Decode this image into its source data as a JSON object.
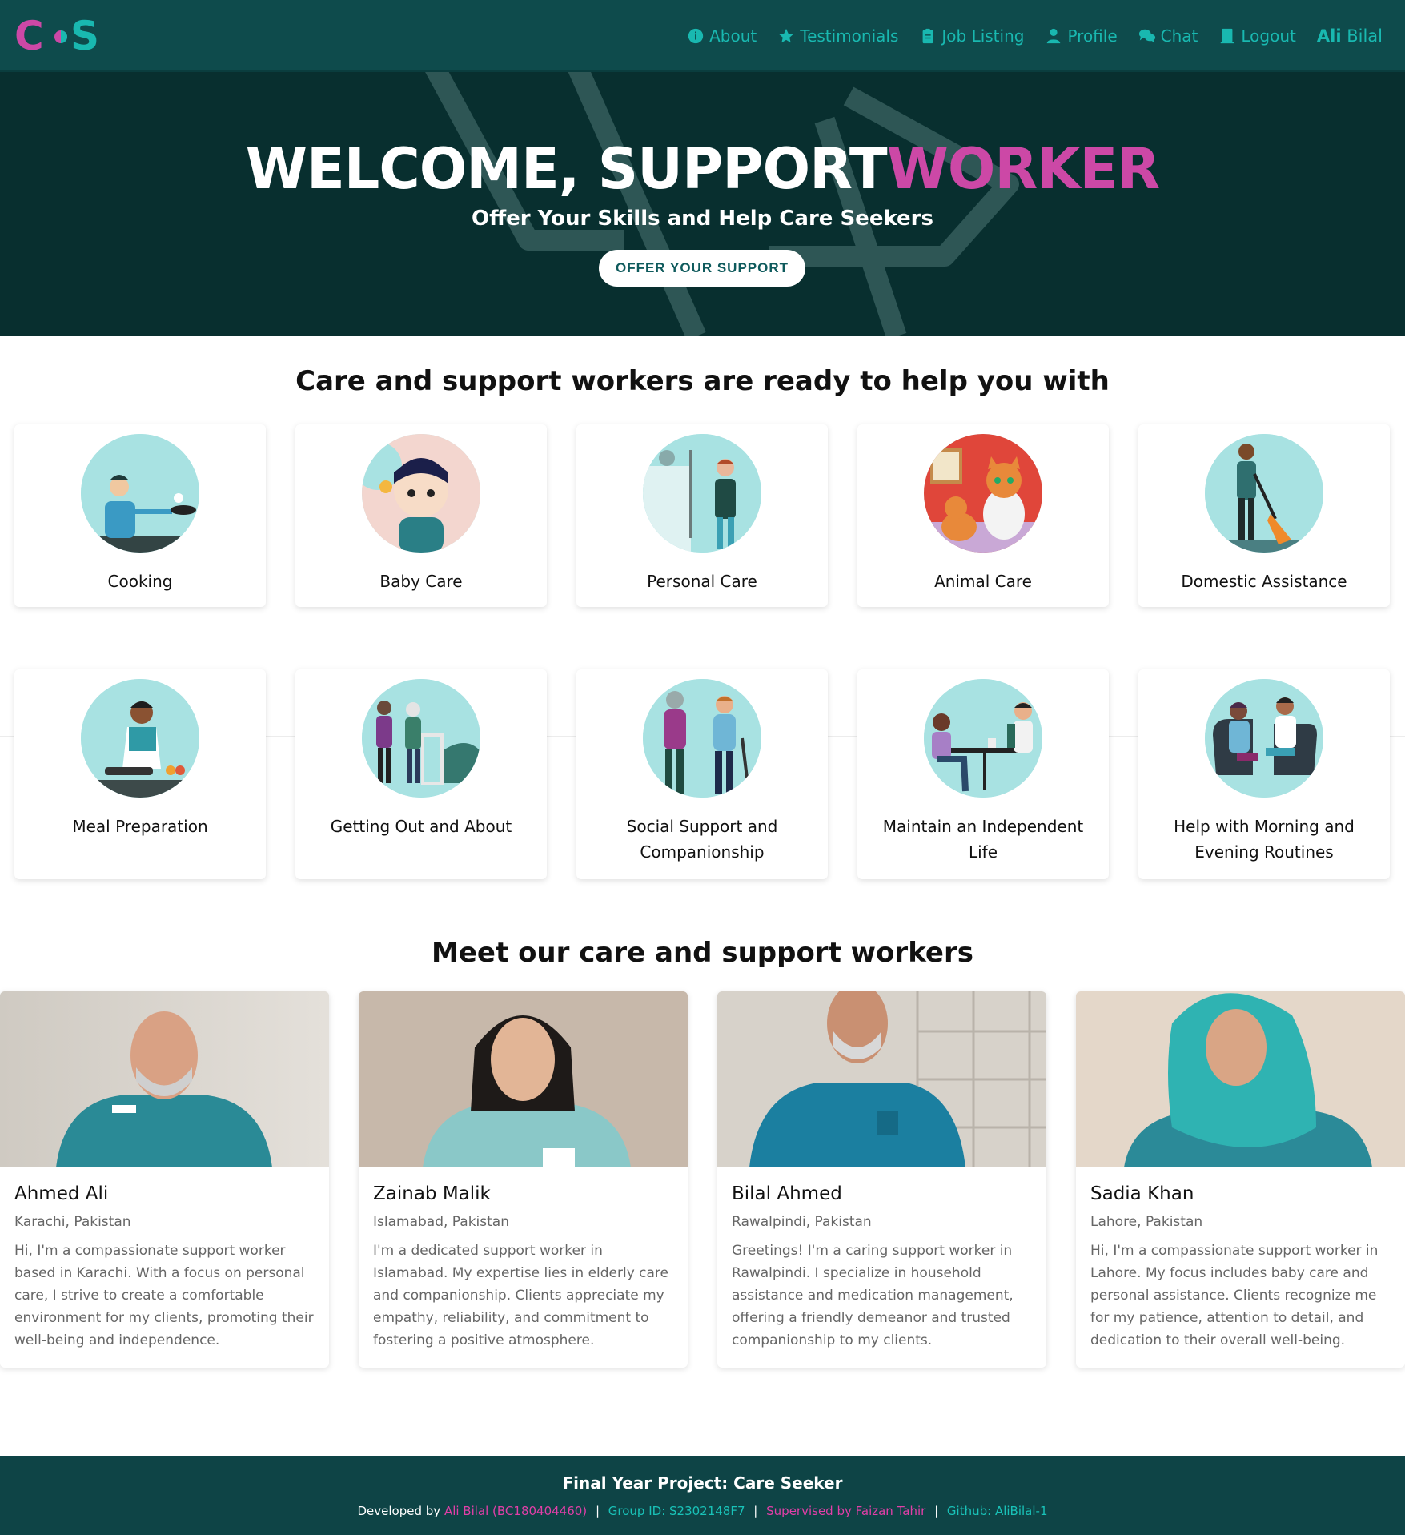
{
  "brand": {
    "logo_text": "C•S",
    "colors": {
      "pink": "#cc48a6",
      "teal": "#19b8b0",
      "dark": "#0e4b4c"
    }
  },
  "nav": {
    "items": [
      {
        "label": "About",
        "icon": "info-circle-icon"
      },
      {
        "label": "Testimonials",
        "icon": "star-icon"
      },
      {
        "label": "Job Listing",
        "icon": "clipboard-icon"
      },
      {
        "label": "Profile",
        "icon": "user-icon"
      },
      {
        "label": "Chat",
        "icon": "chat-bubbles-icon"
      },
      {
        "label": "Logout",
        "icon": "book-icon"
      }
    ],
    "user_first": "Ali",
    "user_last": "Bilal"
  },
  "hero": {
    "title_white": "WELCOME, SUPPORT",
    "title_accent": "WORKER",
    "subtitle": "Offer Your Skills and Help Care Seekers",
    "button": "OFFER YOUR SUPPORT"
  },
  "services": {
    "title": "Care and support workers are ready to help you with",
    "items": [
      {
        "label": "Cooking"
      },
      {
        "label": "Baby Care"
      },
      {
        "label": "Personal Care"
      },
      {
        "label": "Animal Care"
      },
      {
        "label": "Domestic Assistance"
      },
      {
        "label": "Meal Preparation"
      },
      {
        "label": "Getting Out and About"
      },
      {
        "label": "Social Support and Companionship"
      },
      {
        "label": "Maintain an Independent Life"
      },
      {
        "label": "Help with Morning and Evening Routines"
      }
    ]
  },
  "workers": {
    "title": "Meet our care and support workers",
    "items": [
      {
        "name": "Ahmed Ali",
        "location": "Karachi, Pakistan",
        "bio": "Hi, I'm a compassionate support worker based in Karachi. With a focus on personal care, I strive to create a comfortable environment for my clients, promoting their well-being and independence."
      },
      {
        "name": "Zainab Malik",
        "location": "Islamabad, Pakistan",
        "bio": "I'm a dedicated support worker in Islamabad. My expertise lies in elderly care and companionship. Clients appreciate my empathy, reliability, and commitment to fostering a positive atmosphere."
      },
      {
        "name": "Bilal Ahmed",
        "location": "Rawalpindi, Pakistan",
        "bio": "Greetings! I'm a caring support worker in Rawalpindi. I specialize in household assistance and medication management, offering a friendly demeanor and trusted companionship to my clients."
      },
      {
        "name": "Sadia Khan",
        "location": "Lahore, Pakistan",
        "bio": "Hi, I'm a compassionate support worker in Lahore. My focus includes baby care and personal assistance. Clients recognize me for my patience, attention to detail, and dedication to their overall well-being."
      }
    ]
  },
  "footer": {
    "title": "Final Year Project: Care Seeker",
    "developed_by": "Developed by",
    "developer": "Ali Bilal (BC180404460)",
    "group": "Group ID: S2302148F7",
    "supervisor": "Supervised by Faizan Tahir",
    "github": "Github: AliBilal-1"
  }
}
